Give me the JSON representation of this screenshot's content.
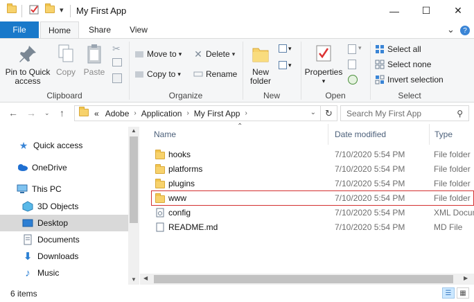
{
  "window": {
    "title": "My First App",
    "minimize_glyph": "—",
    "maximize_glyph": "☐",
    "close_glyph": "✕",
    "qat_dropdown_glyph": "▾"
  },
  "ribbon_tabs": {
    "file": "File",
    "home": "Home",
    "share": "Share",
    "view": "View",
    "expand_glyph": "⌄",
    "help_glyph": "?"
  },
  "ribbon": {
    "clipboard": {
      "pin_label": "Pin to Quick access",
      "copy_label": "Copy",
      "paste_label": "Paste",
      "group_label": "Clipboard"
    },
    "organize": {
      "move_to": "Move to",
      "copy_to": "Copy to",
      "delete": "Delete",
      "rename": "Rename",
      "group_label": "Organize"
    },
    "new": {
      "new_folder": "New folder",
      "group_label": "New"
    },
    "open": {
      "properties": "Properties",
      "group_label": "Open"
    },
    "select": {
      "select_all": "Select all",
      "select_none": "Select none",
      "invert_selection": "Invert selection",
      "group_label": "Select"
    }
  },
  "address": {
    "overflow": "«",
    "crumbs": [
      "Adobe",
      "Application",
      "My First App"
    ],
    "search_placeholder": "Search My First App"
  },
  "nav_pane": {
    "items": [
      "Quick access",
      "OneDrive",
      "This PC",
      "3D Objects",
      "Desktop",
      "Documents",
      "Downloads",
      "Music"
    ]
  },
  "file_list": {
    "columns": [
      "Name",
      "Date modified",
      "Type"
    ],
    "rows": [
      {
        "name": "hooks",
        "date": "7/10/2020 5:54 PM",
        "type": "File folder"
      },
      {
        "name": "platforms",
        "date": "7/10/2020 5:54 PM",
        "type": "File folder"
      },
      {
        "name": "plugins",
        "date": "7/10/2020 5:54 PM",
        "type": "File folder"
      },
      {
        "name": "www",
        "date": "7/10/2020 5:54 PM",
        "type": "File folder"
      },
      {
        "name": "config",
        "date": "7/10/2020 5:54 PM",
        "type": "XML Document"
      },
      {
        "name": "README.md",
        "date": "7/10/2020 5:54 PM",
        "type": "MD File"
      }
    ]
  },
  "status": {
    "item_count": "6 items"
  },
  "colors": {
    "accent": "#1979ca",
    "folder": "#f7d26c",
    "selection": "#cce8ff",
    "highlight_border": "#d32f2f"
  }
}
